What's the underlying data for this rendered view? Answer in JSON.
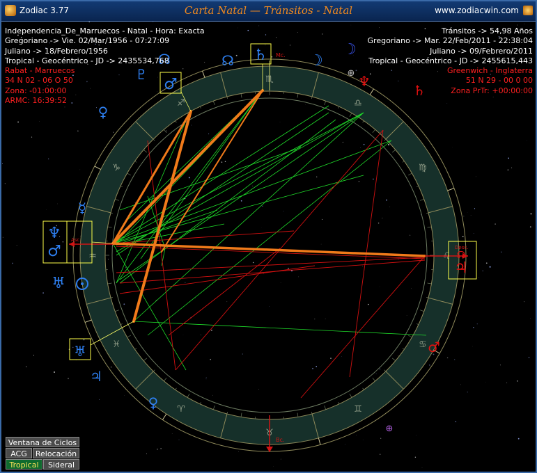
{
  "window": {
    "app_name": "Zodiac 3.77",
    "title": "Carta Natal — Tránsitos - Natal",
    "site": "www.zodiacwin.com"
  },
  "natal_info": {
    "line1": "Independencia_De_Marruecos - Natal - Hora: Exacta",
    "line2": "Gregoriano -> Vie. 02/Mar/1956 - 07:27:09",
    "line3": "Juliano -> 18/Febrero/1956",
    "line4": "Tropical - Geocéntrico - JD -> 2435534,768",
    "line5": "Rabat - Marruecos",
    "line6": "34 N 02 - 06 O 50",
    "line7": "Zona: -01:00:00",
    "line8": "ARMC: 16:39:52"
  },
  "transit_info": {
    "line1": "Tránsitos -> 54,98 Años",
    "line2": "Gregoriano -> Mar. 22/Feb/2011 - 22:38:04",
    "line3": "Juliano -> 09/Febrero/2011",
    "line4": "Tropical - Geocéntrico - JD -> 2455615,443",
    "line5": "Greenwich - Inglaterra",
    "line6": "51 N 29 - 00 0 00",
    "line7": "Zona PrTr: +00:00:00"
  },
  "axes": {
    "mc": "Mc.",
    "bc": "Bc.",
    "asc": "Asc.",
    "desc": "Desc."
  },
  "buttons": {
    "cycles": "Ventana de Ciclos",
    "acg": "ACG",
    "relocation": "Relocación",
    "tropical": "Tropical",
    "sidereal": "Sideral"
  },
  "zodiac_signs": [
    {
      "name": "Aries",
      "glyph": "♈",
      "angle": 240
    },
    {
      "name": "Taurus",
      "glyph": "♉",
      "angle": 270
    },
    {
      "name": "Gemini",
      "glyph": "♊",
      "angle": 300
    },
    {
      "name": "Cancer",
      "glyph": "♋",
      "angle": 330
    },
    {
      "name": "Leo",
      "glyph": "♌",
      "angle": 360
    },
    {
      "name": "Virgo",
      "glyph": "♍",
      "angle": 30
    },
    {
      "name": "Libra",
      "glyph": "♎",
      "angle": 60
    },
    {
      "name": "Scorpio",
      "glyph": "♏",
      "angle": 90
    },
    {
      "name": "Sagittarius",
      "glyph": "♐",
      "angle": 120
    },
    {
      "name": "Capricorn",
      "glyph": "♑",
      "angle": 150
    },
    {
      "name": "Aquarius",
      "glyph": "♒",
      "angle": 180
    },
    {
      "name": "Pisces",
      "glyph": "♓",
      "angle": 210
    }
  ],
  "transit_planets": [
    {
      "name": "north-node",
      "glyph": "☊",
      "color": "#2e7ff0",
      "angle": 113
    },
    {
      "name": "mars",
      "glyph": "♂",
      "color": "#2e7ff0",
      "angle": 128,
      "boxed": true
    },
    {
      "name": "venus",
      "glyph": "♀",
      "color": "#2e7ff0",
      "angle": 147
    },
    {
      "name": "mercury",
      "glyph": "☿",
      "color": "#2e7ff0",
      "angle": 164
    },
    {
      "name": "neptune",
      "glyph": "♆",
      "color": "#2e7ff0",
      "angle": 178,
      "boxed": true
    },
    {
      "name": "sun",
      "glyph": "☉",
      "color": "#2e7ff0",
      "angle": 193
    },
    {
      "name": "moon",
      "glyph": "☽",
      "color": "#2e7ff0",
      "angle": 60
    },
    {
      "name": "jupiter",
      "glyph": "♃",
      "color": "#2e7ff0",
      "angle": 220
    },
    {
      "name": "venus-natal",
      "glyph": "♀",
      "color": "#2e7ff0",
      "angle": 243
    },
    {
      "name": "saturn",
      "glyph": "♄",
      "color": "#2e7ff0",
      "angle": 88,
      "boxed": true
    }
  ]
}
